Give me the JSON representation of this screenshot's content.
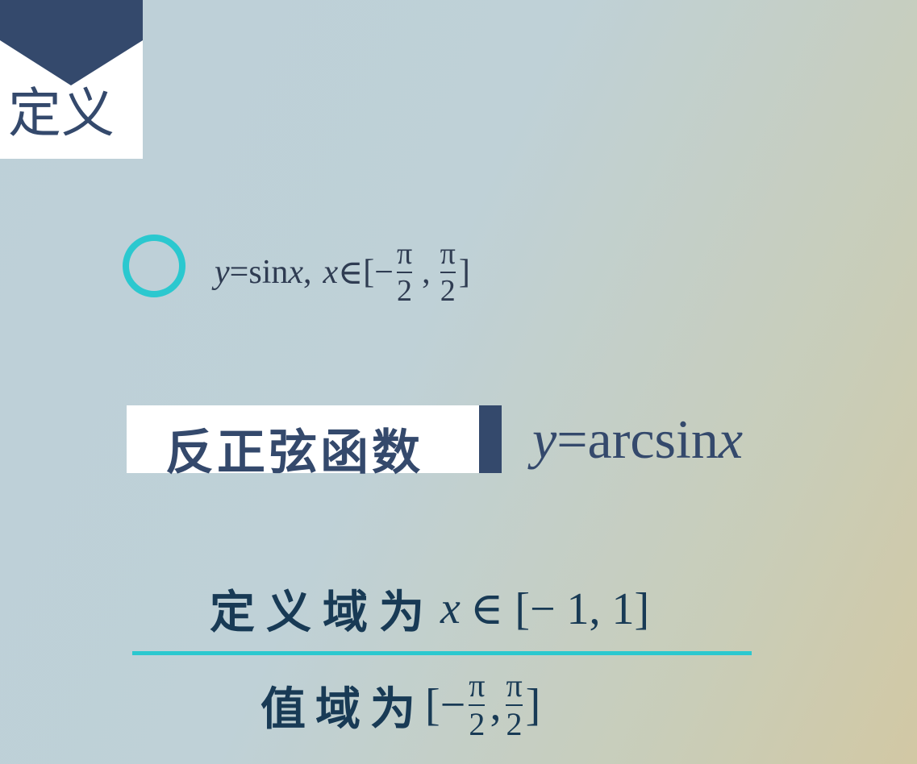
{
  "header": {
    "title": "定义"
  },
  "definition": {
    "equation": {
      "y": "y",
      "eq": "=sin",
      "x": "x",
      "comma": ",",
      "x2": "x",
      "in": "∈",
      "open": "[",
      "minus": "−",
      "frac_num": "π",
      "frac_den": "2",
      "sep": ",",
      "frac2_num": "π",
      "frac2_den": "2",
      "close": "]"
    }
  },
  "inverse": {
    "label": "反正弦函数",
    "formula": {
      "y": "y",
      "eq": "=arcsin",
      "x": "x"
    }
  },
  "domain": {
    "label": "定义域为",
    "x": "x",
    "expr": "∈ [− 1, 1]"
  },
  "range": {
    "label": "值域为",
    "open": "[−",
    "frac_num": "π",
    "frac_den": "2",
    "sep": ",",
    "frac2_num": "π",
    "frac2_den": "2",
    "close": "]"
  },
  "colors": {
    "accent": "#2bc8cf",
    "navy": "#34496c",
    "text_dark": "#183a55"
  },
  "icons": {
    "ring": "ring-bullet-icon"
  }
}
